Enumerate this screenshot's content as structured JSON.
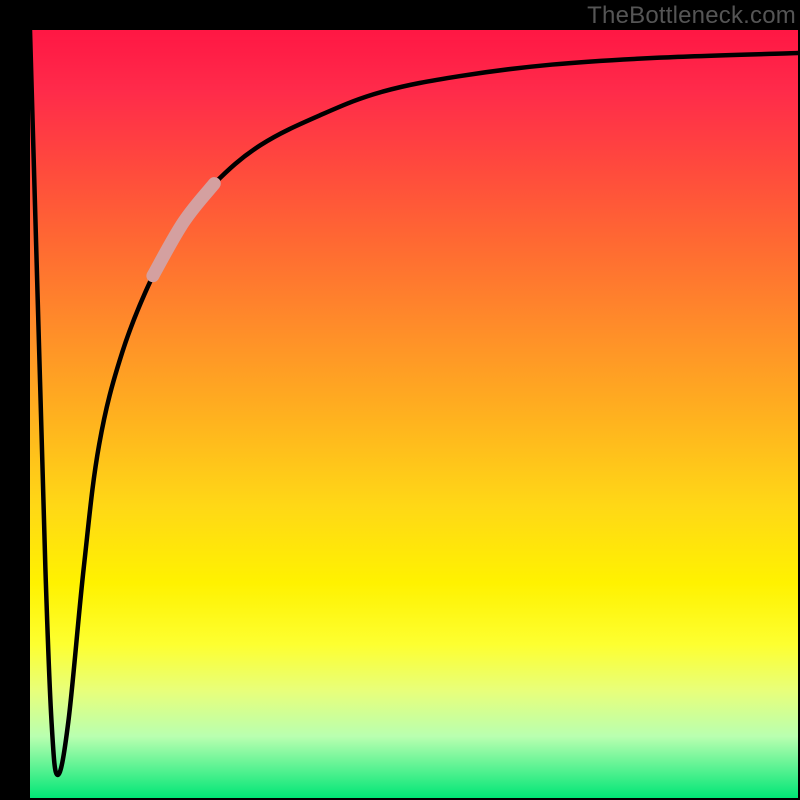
{
  "watermark": "TheBottleneck.com",
  "colors": {
    "frame": "#000000",
    "curve": "#000000",
    "highlight": "#d4a0a0",
    "gradient_top": "#ff1744",
    "gradient_bottom": "#00e676"
  },
  "chart_data": {
    "type": "line",
    "title": "",
    "xlabel": "",
    "ylabel": "",
    "xlim": [
      0,
      100
    ],
    "ylim": [
      0,
      100
    ],
    "grid": false,
    "legend": false,
    "annotations": [
      "TheBottleneck.com"
    ],
    "series": [
      {
        "name": "curve",
        "x": [
          0,
          1,
          2,
          2.8,
          3.6,
          5,
          7,
          9,
          12,
          16,
          20,
          24,
          30,
          38,
          46,
          56,
          68,
          82,
          100
        ],
        "values": [
          100,
          65,
          30,
          10,
          3,
          10,
          30,
          46,
          58,
          68,
          75,
          80,
          85,
          89,
          92,
          94,
          95.5,
          96.4,
          97
        ]
      },
      {
        "name": "highlight-segment",
        "x": [
          16,
          20,
          24
        ],
        "values": [
          68,
          75,
          80
        ]
      }
    ]
  }
}
